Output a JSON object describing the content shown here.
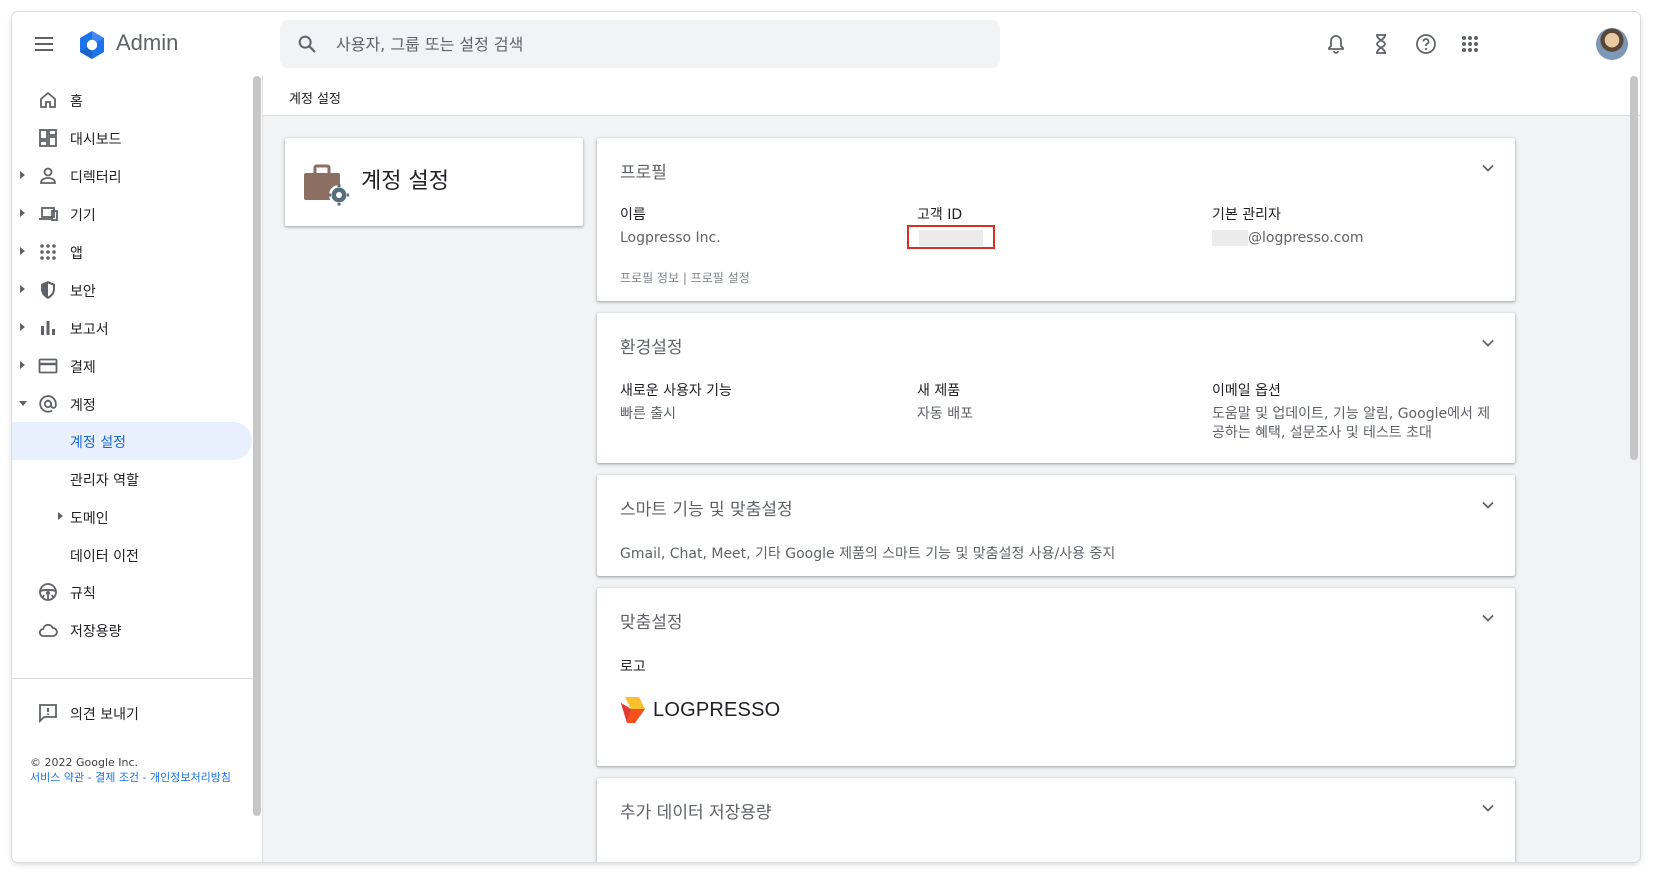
{
  "app": {
    "title": "Admin"
  },
  "search": {
    "placeholder": "사용자, 그룹 또는 설정 검색"
  },
  "topbar": {
    "icons": [
      "bell-icon",
      "hourglass-icon",
      "help-icon",
      "apps-grid-icon"
    ],
    "avatar": "avatar"
  },
  "sidebar": {
    "items": [
      {
        "label": "홈",
        "icon": "home-icon",
        "expandable": false
      },
      {
        "label": "대시보드",
        "icon": "dashboard-icon",
        "expandable": false
      },
      {
        "label": "디렉터리",
        "icon": "person-icon",
        "expandable": true
      },
      {
        "label": "기기",
        "icon": "devices-icon",
        "expandable": true
      },
      {
        "label": "앱",
        "icon": "apps-icon",
        "expandable": true
      },
      {
        "label": "보안",
        "icon": "shield-icon",
        "expandable": true
      },
      {
        "label": "보고서",
        "icon": "bar-chart-icon",
        "expandable": true
      },
      {
        "label": "결제",
        "icon": "credit-card-icon",
        "expandable": true
      },
      {
        "label": "계정",
        "icon": "at-sign-icon",
        "expandable": true,
        "expanded": true
      },
      {
        "label": "계정 설정",
        "sub": true,
        "active": true
      },
      {
        "label": "관리자 역할",
        "sub": true
      },
      {
        "label": "도메인",
        "sub": true,
        "expandable": true
      },
      {
        "label": "데이터 이전",
        "sub": true
      },
      {
        "label": "규칙",
        "icon": "steering-wheel-icon",
        "expandable": false
      },
      {
        "label": "저장용량",
        "icon": "cloud-icon",
        "expandable": false
      }
    ],
    "feedback": "의견 보내기",
    "copyright": "© 2022 Google Inc.",
    "links": [
      "서비스 약관",
      "결제 조건",
      "개인정보처리방침"
    ]
  },
  "breadcrumb": "계정 설정",
  "page_title": "계정 설정",
  "cards": {
    "profile": {
      "title": "프로필",
      "fields": [
        {
          "label": "이름",
          "value": "Logpresso Inc."
        },
        {
          "label": "고객 ID",
          "value": ""
        },
        {
          "label": "기본 관리자",
          "value": "@logpresso.com"
        }
      ],
      "links": [
        "프로필 정보",
        "프로필 설정"
      ],
      "link_separator": "|"
    },
    "preferences": {
      "title": "환경설정",
      "fields": [
        {
          "label": "새로운 사용자 기능",
          "value": "빠른 출시"
        },
        {
          "label": "새 제품",
          "value": "자동 배포"
        },
        {
          "label": "이메일 옵션",
          "value": "도움말 및 업데이트, 기능 알림, Google에서 제공하는 혜택, 설문조사 및 테스트 초대"
        }
      ]
    },
    "smart": {
      "title": "스마트 기능 및 맞춤설정",
      "description": "Gmail, Chat, Meet, 기타 Google 제품의 스마트 기능 및 맞춤설정 사용/사용 중지"
    },
    "personalization": {
      "title": "맞춤설정",
      "logo_label": "로고",
      "logo_text": "LOGPRESSO"
    },
    "storage": {
      "title": "추가 데이터 저장용량"
    }
  },
  "colors": {
    "accent": "#1a73e8",
    "active_bg": "#e8f0fe",
    "highlight_border": "#d93025",
    "brand_orange": "#f9a825",
    "brand_red": "#e53935"
  }
}
